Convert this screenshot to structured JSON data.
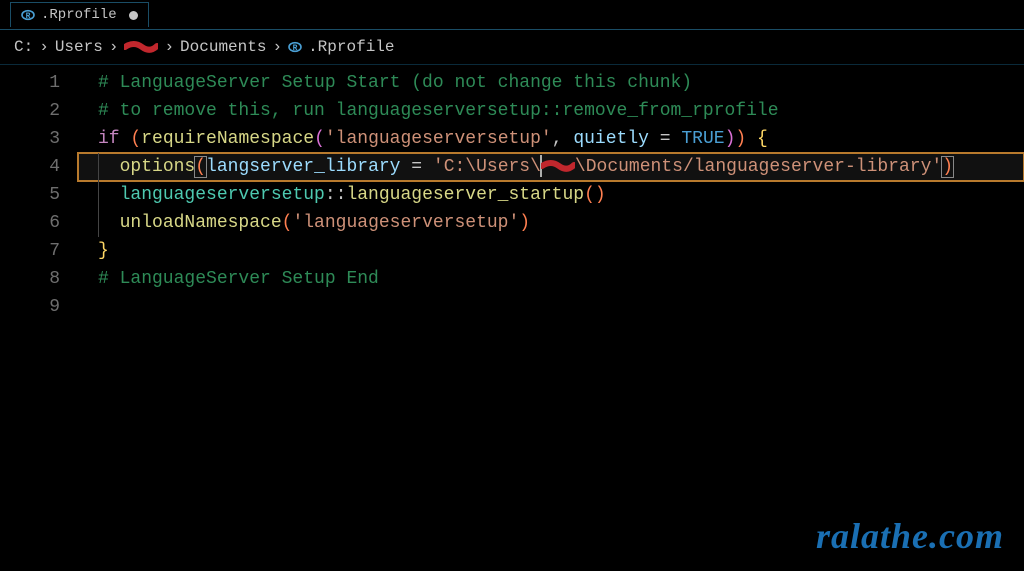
{
  "tab": {
    "label": ".Rprofile",
    "dirty": true
  },
  "breadcrumb": {
    "segments": [
      "C:",
      "Users",
      "[redacted]",
      "Documents",
      ".Rprofile"
    ]
  },
  "lines": {
    "l1": "# LanguageServer Setup Start (do not change this chunk)",
    "l2": "# to remove this, run languageserversetup::remove_from_rprofile",
    "l3": {
      "if": "if",
      "fn": "requireNamespace",
      "s": "'languageserversetup'",
      "p": "quietly",
      "eq": " = ",
      "tr": "TRUE"
    },
    "l4": {
      "fn": "options",
      "p": "langserver_library",
      "eq": " = ",
      "s_a": "'C:\\Users\\",
      "s_b": "\\Documents/languageserver-library'"
    },
    "l5": {
      "ns": "languageserversetup",
      "op": "::",
      "fn": "languageserver_startup"
    },
    "l6": {
      "fn": "unloadNamespace",
      "s": "'languageserversetup'"
    },
    "l8": "# LanguageServer Setup End"
  },
  "gutter": [
    "1",
    "2",
    "3",
    "4",
    "5",
    "6",
    "7",
    "8",
    "9"
  ],
  "watermark": "ralathe.com",
  "colors": {
    "background": "#000000",
    "accent": "#1a4d66",
    "highlight_border": "#b87a2d",
    "comment": "#2e8b57",
    "keyword_flow": "#c586c0",
    "function": "#d7d787",
    "string": "#ce9178",
    "param": "#9cdcfe",
    "constant": "#4a9fd4",
    "namespace": "#4ec9b0"
  }
}
